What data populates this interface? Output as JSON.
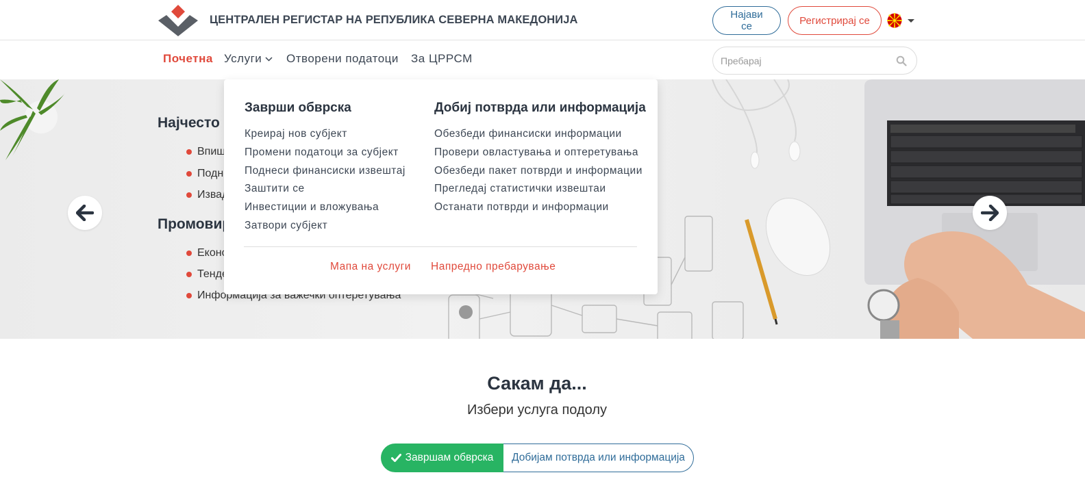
{
  "header": {
    "site_title": "ЦЕНТРАЛЕН РЕГИСТАР НА РЕПУБЛИКА СЕВЕРНА МАКЕДОНИЈА",
    "login_label": "Најави се",
    "register_label": "Регистрирај се",
    "language_icon": "macedonia-flag-icon"
  },
  "nav": {
    "items": [
      {
        "label": "Почетна",
        "active": true
      },
      {
        "label": "Услуги"
      },
      {
        "label": "Отворени податоци"
      },
      {
        "label": "За ЦРРСМ"
      }
    ],
    "search_placeholder": "Пребарај"
  },
  "hero": {
    "heading_1": "Најчесто п",
    "list_1": [
      "Впиш",
      "Подне",
      "Извад"
    ],
    "heading_2": "Промовир",
    "list_2": [
      "Еконо",
      "Тенде",
      "Информација за важечки оптеретувања"
    ]
  },
  "dropdown": {
    "col1_heading": "Заврши обврска",
    "col1_links": [
      "Креирај нов субјект",
      "Промени податоци за субјект",
      "Поднеси финансиски извештај",
      "Заштити се",
      "Инвестиции и вложувања",
      "Затвори субјект"
    ],
    "col2_heading": "Добиј потврда или информација",
    "col2_links": [
      "Обезбеди финансиски информации",
      "Провери овластувања и оптеретувања",
      "Обезбеди пакет потврди и информации",
      "Прегледај статистички извештаи",
      "Останати потврди и информации"
    ],
    "footer_links": [
      "Мапа на услуги",
      "Напредно пребарување"
    ]
  },
  "section": {
    "title": "Сакам да...",
    "subtitle": "Избери услуга подолу",
    "toggle_active": "Завршам обврска",
    "toggle_inactive": "Добијам потврда или информација"
  },
  "colors": {
    "accent_red": "#e0493b",
    "accent_blue": "#2f6c99",
    "accent_green": "#28b463",
    "text_dark": "#2b3440"
  }
}
